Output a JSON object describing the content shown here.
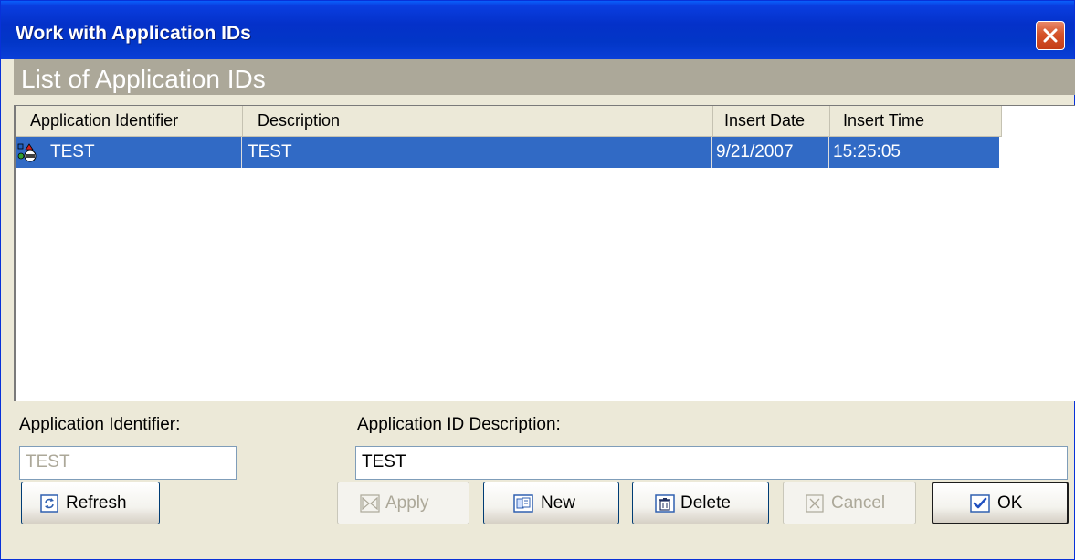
{
  "window": {
    "title": "Work with Application IDs",
    "close_icon": "close-icon",
    "accent_color": "#0a3ee0"
  },
  "section_header": {
    "title": "List of Application IDs"
  },
  "list": {
    "columns": [
      "Application Identifier",
      "Description",
      "Insert Date",
      "Insert Time"
    ],
    "rows": [
      {
        "icon": "application-id-icon",
        "id": "TEST",
        "description": "TEST",
        "insert_date": "9/21/2007",
        "insert_time": "15:25:05",
        "selected": true
      }
    ],
    "selection_color": "#316ac5"
  },
  "form": {
    "app_id_label": "Application Identifier:",
    "app_id_value": "TEST",
    "desc_label": "Application ID Description:",
    "desc_value": "TEST"
  },
  "buttons": {
    "refresh": "Refresh",
    "apply": "Apply",
    "new": "New",
    "delete": "Delete",
    "cancel": "Cancel",
    "ok": "OK"
  }
}
